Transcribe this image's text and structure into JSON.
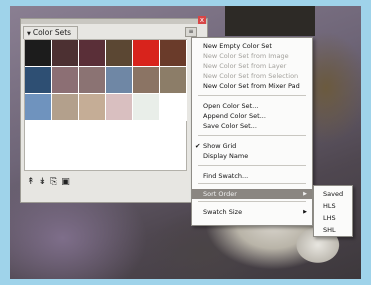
{
  "panel": {
    "title": "Color Sets",
    "menu_button": "≡",
    "close": "x",
    "swatches": [
      "#1c1c1c",
      "#4c3032",
      "#5a2f38",
      "#5b4733",
      "#d8231c",
      "#6a3b2a",
      "#2e4f73",
      "#8c6f74",
      "#8b7373",
      "#6f87a5",
      "#8b7464",
      "#8c7d68",
      "#6f93be",
      "#b3a08c",
      "#c5ad96",
      "#d9bfc0",
      "#e9eee9",
      "#ffffff"
    ],
    "footer_icons": [
      "↟",
      "↡",
      "⎘",
      "▣"
    ]
  },
  "menu": {
    "items": [
      {
        "label": "New Empty Color Set",
        "disabled": false
      },
      {
        "label": "New Color Set from Image",
        "disabled": true
      },
      {
        "label": "New Color Set from Layer",
        "disabled": true
      },
      {
        "label": "New Color Set from Selection",
        "disabled": true
      },
      {
        "label": "New Color Set from Mixer Pad",
        "disabled": false
      },
      {
        "label": "Open Color Set...",
        "disabled": false
      },
      {
        "label": "Append Color Set...",
        "disabled": false
      },
      {
        "label": "Save Color Set...",
        "disabled": false
      },
      {
        "label": "Show Grid",
        "disabled": false,
        "checked": true
      },
      {
        "label": "Display Name",
        "disabled": false
      },
      {
        "label": "Find Swatch...",
        "disabled": false
      },
      {
        "label": "Sort Order",
        "disabled": false,
        "submenu": true,
        "highlighted": true
      },
      {
        "label": "Swatch Size",
        "disabled": false,
        "submenu": true
      }
    ],
    "check_glyph": "✔",
    "arrow_glyph": "▶"
  },
  "submenu": {
    "items": [
      "Saved",
      "HLS",
      "LHS",
      "SHL"
    ]
  }
}
